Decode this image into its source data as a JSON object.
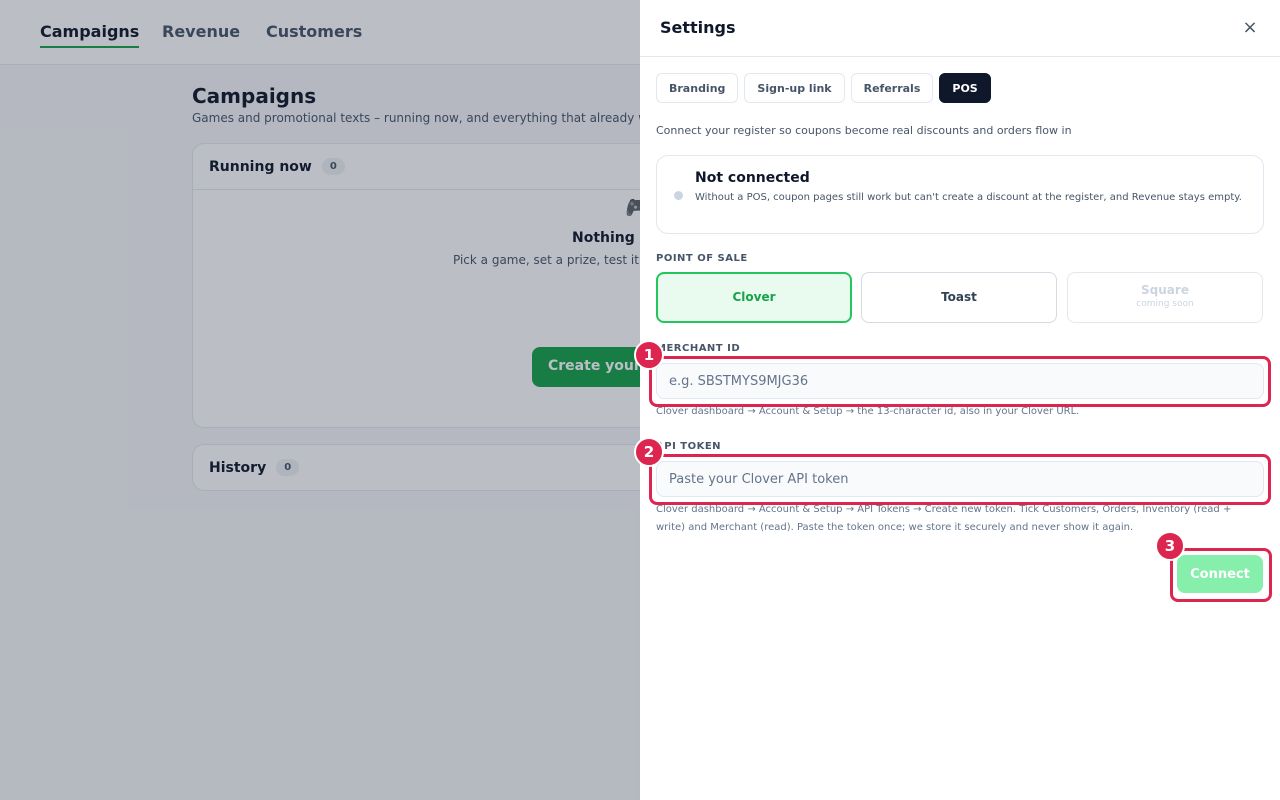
{
  "nav": {
    "tabs": [
      "Campaigns",
      "Revenue",
      "Customers"
    ]
  },
  "main": {
    "title": "Campaigns",
    "subtitle": "Games and promotional texts – running now, and everything that already we",
    "running": {
      "label": "Running now",
      "count": "0",
      "icon": "gamepad-icon",
      "empty_title": "Nothing ru",
      "empty_desc": "Pick a game, set a prize, test it c takes it fr",
      "create_label": "Create your f"
    },
    "history": {
      "label": "History",
      "count": "0"
    }
  },
  "drawer": {
    "title": "Settings",
    "close_icon": "×",
    "tabs": [
      "Branding",
      "Sign-up link",
      "Referrals",
      "POS"
    ],
    "intro": "Connect your register so coupons become real discounts and orders flow in",
    "status": {
      "title": "Not connected",
      "desc": "Without a POS, coupon pages still work but can't create a discount at the register, and Revenue stays empty."
    },
    "pos_label": "POINT OF SALE",
    "pos_options": [
      {
        "name": "Clover",
        "selected": true
      },
      {
        "name": "Toast"
      },
      {
        "name": "Square",
        "note": "coming soon"
      }
    ],
    "merchant": {
      "label": "MERCHANT ID",
      "placeholder": "e.g. SBSTMYS9MJG36",
      "help": "Clover dashboard → Account & Setup → the 13-character id, also in your Clover URL."
    },
    "token": {
      "label": "API TOKEN",
      "placeholder": "Paste your Clover API token",
      "help": "Clover dashboard → Account & Setup → API Tokens → Create new token. Tick Customers, Orders, Inventory (read + write) and Merchant (read). Paste the token once; we store it securely and never show it again."
    },
    "connect_label": "Connect"
  },
  "annotations": [
    "1",
    "2",
    "3"
  ],
  "colors": {
    "accent": "#16a34a",
    "highlight": "#dc2650"
  }
}
